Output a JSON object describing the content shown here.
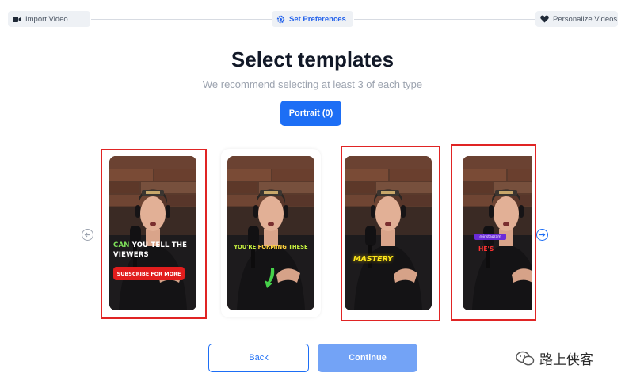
{
  "stepper": {
    "steps": [
      {
        "label": "Import Video",
        "icon": "video-camera-icon"
      },
      {
        "label": "Set Preferences",
        "icon": "gear-icon"
      },
      {
        "label": "Personalize Videos",
        "icon": "heart-icon"
      }
    ],
    "active_index": 1
  },
  "header": {
    "title": "Select templates",
    "subtitle": "We recommend selecting at least 3 of each type"
  },
  "filter": {
    "portrait_label": "Portrait (0)"
  },
  "carousel": {
    "prev_icon": "chevron-left-icon",
    "next_icon": "chevron-right-icon",
    "templates": [
      {
        "selected": true,
        "caption_highlight": "CAN",
        "caption_rest_line1": " YOU TELL THE",
        "caption_line2": "VIEWERS",
        "pill": "SUBSCRIBE FOR MORE"
      },
      {
        "selected": false,
        "caption_a": "YOU'RE ",
        "caption_b": "FORMING",
        "caption_c": " THESE",
        "icon": "down-arrow-icon"
      },
      {
        "selected": true,
        "caption": "MASTERY"
      },
      {
        "selected": true,
        "caption": "HE'S",
        "tag": "@instagram"
      }
    ]
  },
  "actions": {
    "back_label": "Back",
    "continue_label": "Continue"
  },
  "watermark": {
    "text": "路上侠客",
    "icon": "wechat-icon"
  },
  "colors": {
    "accent": "#1d6ef5",
    "selection": "#e02424",
    "continue_disabled": "#73a3f6"
  }
}
